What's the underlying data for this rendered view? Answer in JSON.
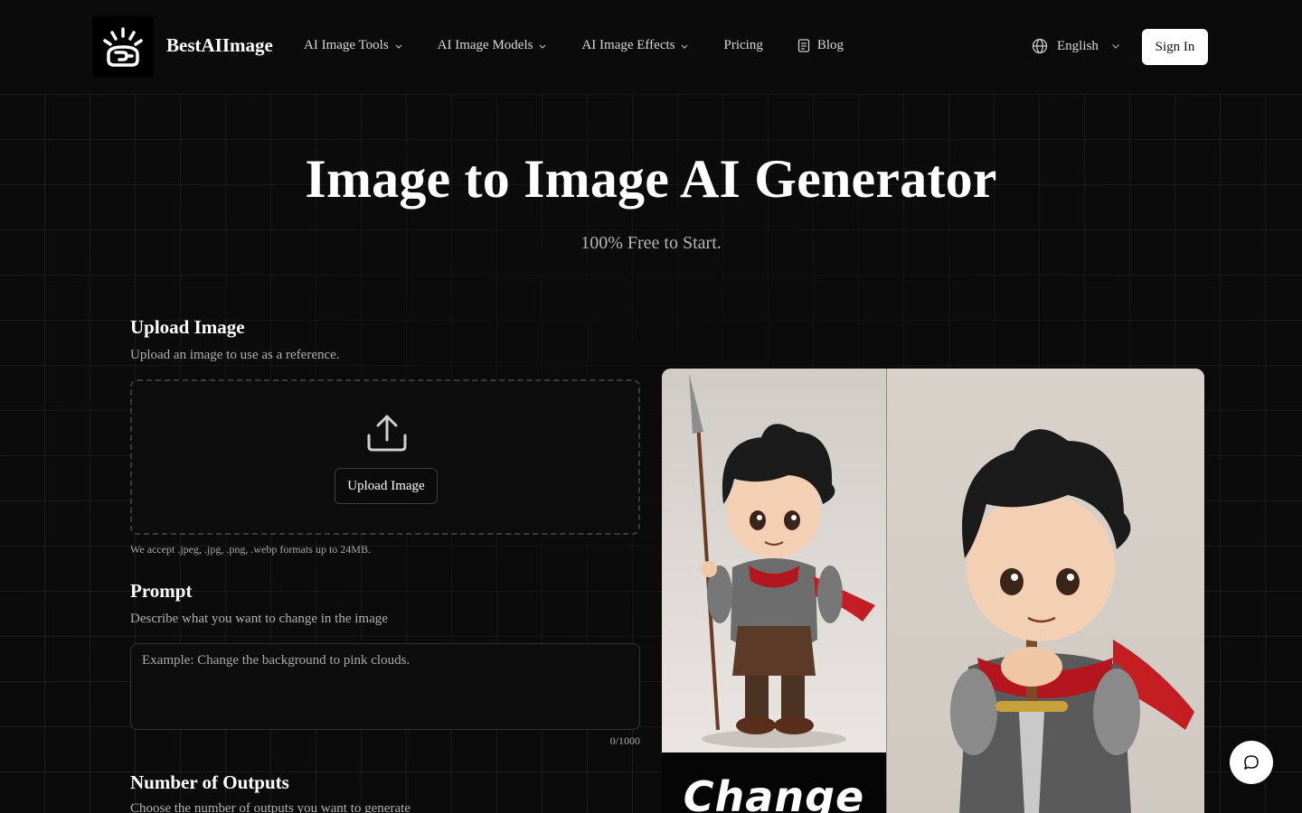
{
  "header": {
    "brand": "BestAIImage",
    "nav": {
      "tools": "AI Image Tools",
      "models": "AI Image Models",
      "effects": "AI Image Effects",
      "pricing": "Pricing",
      "blog": "Blog"
    },
    "language": "English",
    "signin": "Sign In"
  },
  "hero": {
    "title": "Image to Image AI Generator",
    "subtitle": "100% Free to Start."
  },
  "upload": {
    "title": "Upload Image",
    "description": "Upload an image to use as a reference.",
    "button": "Upload Image",
    "note": "We accept .jpeg, .jpg, .png, .webp formats up to 24MB."
  },
  "prompt": {
    "title": "Prompt",
    "description": "Describe what you want to change in the image",
    "placeholder": "Example: Change the background to pink clouds.",
    "counter": "0/1000"
  },
  "outputs": {
    "title": "Number of Outputs",
    "description": "Choose the number of outputs you want to generate"
  },
  "preview": {
    "caption": "Change"
  },
  "colors": {
    "background": "#0b0b0b",
    "accent": "#ffffff",
    "muted_text": "#b0b0b0"
  }
}
